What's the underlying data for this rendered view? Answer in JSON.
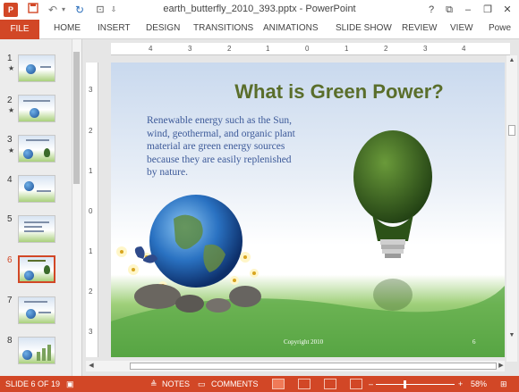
{
  "titlebar": {
    "title": "earth_butterfly_2010_393.pptx - PowerPoint",
    "logo": "P",
    "help": "?",
    "minimize": "–",
    "restore": "❐",
    "close": "✕"
  },
  "ribbon": {
    "tabs": [
      "FILE",
      "HOME",
      "INSERT",
      "DESIGN",
      "TRANSITIONS",
      "ANIMATIONS",
      "SLIDE SHOW",
      "REVIEW",
      "VIEW",
      "Powe"
    ]
  },
  "ruler": {
    "h_ticks": [
      "4",
      "3",
      "2",
      "1",
      "0",
      "1",
      "2",
      "3",
      "4"
    ],
    "v_ticks": [
      "3",
      "2",
      "1",
      "0",
      "1",
      "2",
      "3"
    ]
  },
  "thumbnails": [
    {
      "num": "1",
      "star": "★"
    },
    {
      "num": "2",
      "star": "★"
    },
    {
      "num": "3",
      "star": "★"
    },
    {
      "num": "4",
      "star": ""
    },
    {
      "num": "5",
      "star": ""
    },
    {
      "num": "6",
      "star": ""
    },
    {
      "num": "7",
      "star": ""
    },
    {
      "num": "8",
      "star": ""
    }
  ],
  "slide": {
    "title": "What is Green Power?",
    "body": "Renewable energy such as the Sun, wind, geothermal, and organic plant material are green energy sources because they are easily replenished by nature.",
    "footer": "Copyright 2010",
    "number": "6"
  },
  "statusbar": {
    "slide_info": "SLIDE 6 OF 19",
    "notes": "NOTES",
    "comments": "COMMENTS",
    "zoom_minus": "–",
    "zoom_plus": "+",
    "zoom": "58%"
  },
  "colors": {
    "accent": "#d24726",
    "title_green": "#5a6e2b",
    "body_blue": "#3d5a99"
  }
}
